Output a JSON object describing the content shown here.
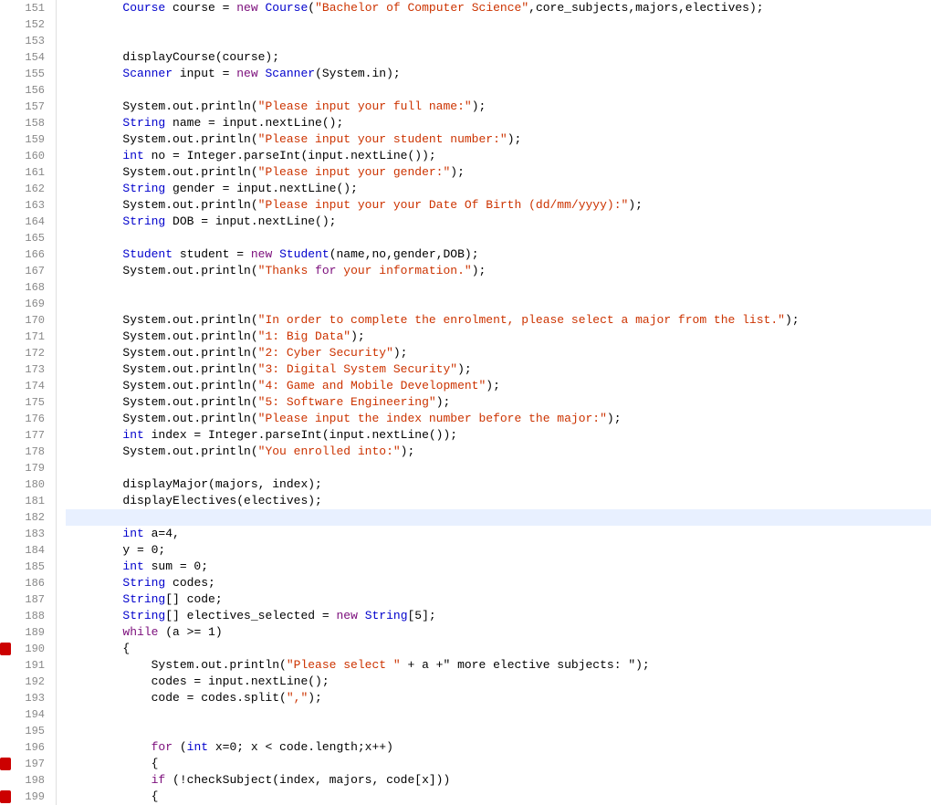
{
  "lines": [
    {
      "num": 151,
      "marker": false,
      "highlighted": false,
      "content": "        Course course = new Course(\"Bachelor of Computer Science\",core_subjects,majors,electives);"
    },
    {
      "num": 152,
      "marker": false,
      "highlighted": false,
      "content": ""
    },
    {
      "num": 153,
      "marker": false,
      "highlighted": false,
      "content": ""
    },
    {
      "num": 154,
      "marker": false,
      "highlighted": false,
      "content": "        displayCourse(course);"
    },
    {
      "num": 155,
      "marker": false,
      "highlighted": false,
      "content": "        Scanner input = new Scanner(System.in);"
    },
    {
      "num": 156,
      "marker": false,
      "highlighted": false,
      "content": ""
    },
    {
      "num": 157,
      "marker": false,
      "highlighted": false,
      "content": "        System.out.println(\"Please input your full name:\");"
    },
    {
      "num": 158,
      "marker": false,
      "highlighted": false,
      "content": "        String name = input.nextLine();"
    },
    {
      "num": 159,
      "marker": false,
      "highlighted": false,
      "content": "        System.out.println(\"Please input your student number:\");"
    },
    {
      "num": 160,
      "marker": false,
      "highlighted": false,
      "content": "        int no = Integer.parseInt(input.nextLine());"
    },
    {
      "num": 161,
      "marker": false,
      "highlighted": false,
      "content": "        System.out.println(\"Please input your gender:\");"
    },
    {
      "num": 162,
      "marker": false,
      "highlighted": false,
      "content": "        String gender = input.nextLine();"
    },
    {
      "num": 163,
      "marker": false,
      "highlighted": false,
      "content": "        System.out.println(\"Please input your your Date Of Birth (dd/mm/yyyy):\");"
    },
    {
      "num": 164,
      "marker": false,
      "highlighted": false,
      "content": "        String DOB = input.nextLine();"
    },
    {
      "num": 165,
      "marker": false,
      "highlighted": false,
      "content": ""
    },
    {
      "num": 166,
      "marker": false,
      "highlighted": false,
      "content": "        Student student = new Student(name,no,gender,DOB);"
    },
    {
      "num": 167,
      "marker": false,
      "highlighted": false,
      "content": "        System.out.println(\"Thanks for your information.\");"
    },
    {
      "num": 168,
      "marker": false,
      "highlighted": false,
      "content": ""
    },
    {
      "num": 169,
      "marker": false,
      "highlighted": false,
      "content": ""
    },
    {
      "num": 170,
      "marker": false,
      "highlighted": false,
      "content": "        System.out.println(\"In order to complete the enrolment, please select a major from the list.\");"
    },
    {
      "num": 171,
      "marker": false,
      "highlighted": false,
      "content": "        System.out.println(\"1: Big Data\");"
    },
    {
      "num": 172,
      "marker": false,
      "highlighted": false,
      "content": "        System.out.println(\"2: Cyber Security\");"
    },
    {
      "num": 173,
      "marker": false,
      "highlighted": false,
      "content": "        System.out.println(\"3: Digital System Security\");"
    },
    {
      "num": 174,
      "marker": false,
      "highlighted": false,
      "content": "        System.out.println(\"4: Game and Mobile Development\");"
    },
    {
      "num": 175,
      "marker": false,
      "highlighted": false,
      "content": "        System.out.println(\"5: Software Engineering\");"
    },
    {
      "num": 176,
      "marker": false,
      "highlighted": false,
      "content": "        System.out.println(\"Please input the index number before the major:\");"
    },
    {
      "num": 177,
      "marker": false,
      "highlighted": false,
      "content": "        int index = Integer.parseInt(input.nextLine());"
    },
    {
      "num": 178,
      "marker": false,
      "highlighted": false,
      "content": "        System.out.println(\"You enrolled into:\");"
    },
    {
      "num": 179,
      "marker": false,
      "highlighted": false,
      "content": ""
    },
    {
      "num": 180,
      "marker": false,
      "highlighted": false,
      "content": "        displayMajor(majors, index);"
    },
    {
      "num": 181,
      "marker": false,
      "highlighted": false,
      "content": "        displayElectives(electives);"
    },
    {
      "num": 182,
      "marker": false,
      "highlighted": true,
      "content": ""
    },
    {
      "num": 183,
      "marker": false,
      "highlighted": false,
      "content": "        int a=4,"
    },
    {
      "num": 184,
      "marker": false,
      "highlighted": false,
      "content": "        y = 0;"
    },
    {
      "num": 185,
      "marker": false,
      "highlighted": false,
      "content": "        int sum = 0;"
    },
    {
      "num": 186,
      "marker": false,
      "highlighted": false,
      "content": "        String codes;"
    },
    {
      "num": 187,
      "marker": false,
      "highlighted": false,
      "content": "        String[] code;"
    },
    {
      "num": 188,
      "marker": false,
      "highlighted": false,
      "content": "        String[] electives_selected = new String[5];"
    },
    {
      "num": 189,
      "marker": false,
      "highlighted": false,
      "content": "        while (a >= 1)"
    },
    {
      "num": 190,
      "marker": true,
      "highlighted": false,
      "content": "        {"
    },
    {
      "num": 191,
      "marker": false,
      "highlighted": false,
      "content": "            System.out.println(\"Please select \" + a +\" more elective subjects: \");"
    },
    {
      "num": 192,
      "marker": false,
      "highlighted": false,
      "content": "            codes = input.nextLine();"
    },
    {
      "num": 193,
      "marker": false,
      "highlighted": false,
      "content": "            code = codes.split(\",\");"
    },
    {
      "num": 194,
      "marker": false,
      "highlighted": false,
      "content": ""
    },
    {
      "num": 195,
      "marker": false,
      "highlighted": false,
      "content": ""
    },
    {
      "num": 196,
      "marker": false,
      "highlighted": false,
      "content": "            for (int x=0; x < code.length;x++)"
    },
    {
      "num": 197,
      "marker": true,
      "highlighted": false,
      "content": "            {"
    },
    {
      "num": 198,
      "marker": false,
      "highlighted": false,
      "content": "            if (!checkSubject(index, majors, code[x]))"
    },
    {
      "num": 199,
      "marker": true,
      "highlighted": false,
      "content": "            {"
    }
  ]
}
